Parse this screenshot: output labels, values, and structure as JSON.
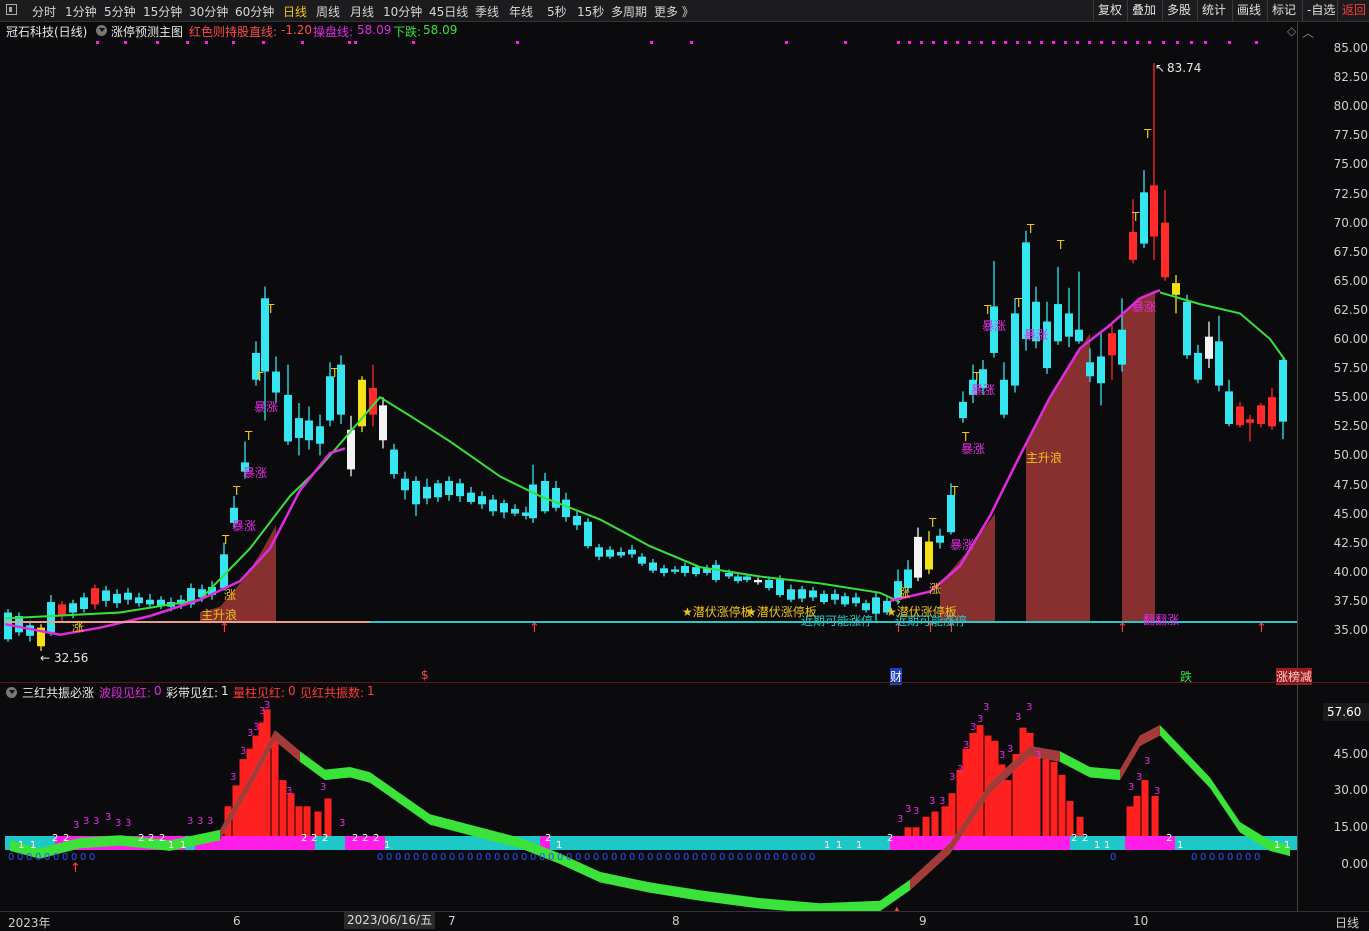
{
  "periods": [
    "分时",
    "1分钟",
    "5分钟",
    "15分钟",
    "30分钟",
    "60分钟",
    "日线",
    "周线",
    "月线",
    "10分钟",
    "45日线",
    "季线",
    "年线",
    "5秒",
    "15秒",
    "多周期",
    "更多 》"
  ],
  "active_period": "日线",
  "tools": [
    "复权",
    "叠加",
    "多股",
    "统计",
    "画线",
    "标记",
    "-自选",
    "返回"
  ],
  "main_header": {
    "stock": "冠石科技(日线)",
    "indicator": "涨停预测主图",
    "red_line_label": "红色则持股直线:",
    "red_line_value": "-1.20",
    "op_line_label": "操盘线:",
    "op_line_value": "58.09",
    "down_label": "下跌:",
    "down_value": "58.09"
  },
  "price_axis": [
    "85.00",
    "82.50",
    "80.00",
    "77.50",
    "75.00",
    "72.50",
    "70.00",
    "67.50",
    "65.00",
    "62.50",
    "60.00",
    "57.50",
    "55.00",
    "52.50",
    "50.00",
    "47.50",
    "45.00",
    "42.50",
    "40.00",
    "37.50",
    "35.00"
  ],
  "high_mark": "83.74",
  "low_mark": "32.56",
  "annotations": {
    "zhang": "涨",
    "bao_zhang": "暴涨",
    "zhu_sheng_lang": "主升浪",
    "qian_fu": "★潜伏涨停板",
    "jin_qi": "近期可能涨停",
    "t": "T",
    "bottom_s": "$",
    "cai": "财",
    "die": "跌",
    "zhang_jian": "涨榜减",
    "liu_zhang": "翻翻涨"
  },
  "sub_header": {
    "name": "三红共振必涨",
    "wave_label": "波段见红:",
    "wave_value": "0",
    "band_label": "彩带见红:",
    "band_value": "1",
    "bar_label": "量柱见红:",
    "bar_value": "0",
    "resonance_label": "见红共振数:",
    "resonance_value": "1"
  },
  "sub_axis": [
    "57.60",
    "45.00",
    "30.00",
    "15.00",
    "0.00"
  ],
  "current_value": "57.60",
  "x_axis": {
    "year": "2023年",
    "months": [
      "6",
      "7",
      "8",
      "9",
      "10"
    ],
    "cursor_date": "2023/06/16/五",
    "period": "日线"
  },
  "colors": {
    "up": "#ff2a2a",
    "down": "#35e5f0",
    "ma_green": "#36e23a",
    "ma_magenta": "#e02be0",
    "band_cyan": "#1fc8c8",
    "band_magenta": "#ff1ee8",
    "fill_brown": "#a83a3a"
  }
}
